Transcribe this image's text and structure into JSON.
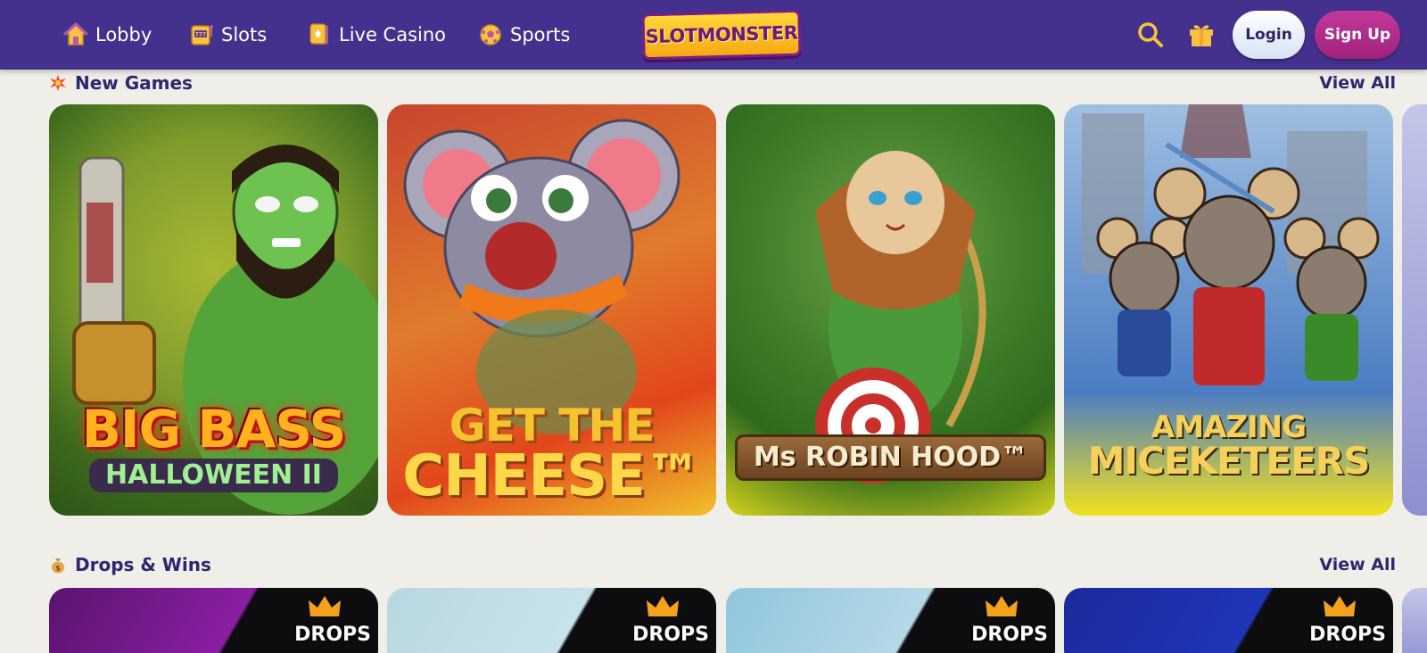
{
  "nav": {
    "items": [
      {
        "label": "Lobby",
        "icon": "house-icon"
      },
      {
        "label": "Slots",
        "icon": "slot-machine-icon"
      },
      {
        "label": "Live Casino",
        "icon": "playing-card-icon"
      },
      {
        "label": "Sports",
        "icon": "soccer-ball-icon"
      }
    ],
    "logo_text": "SLOTMONSTER",
    "login_label": "Login",
    "signup_label": "Sign Up"
  },
  "sections": [
    {
      "title": "New Games",
      "icon": "explosion-icon",
      "view_all": "View All",
      "games": [
        {
          "title_line1": "BIG BASS",
          "title_line2": "HALLOWEEN II"
        },
        {
          "title_line1": "GET THE",
          "title_line2": "CHEESE™"
        },
        {
          "title_line1": "Ms ROBIN HOOD™",
          "title_line2": ""
        },
        {
          "title_line1": "AMAZING",
          "title_line2": "MICEKETEERS"
        }
      ]
    },
    {
      "title": "Drops & Wins",
      "icon": "money-bag-icon",
      "view_all": "View All",
      "badge_text": "DROPS"
    }
  ],
  "colors": {
    "nav_bg": "#44318d",
    "page_bg": "#efeee9",
    "heading": "#2f2670",
    "signup": "#b02e8c",
    "icon_accent": "#f7c23e"
  }
}
